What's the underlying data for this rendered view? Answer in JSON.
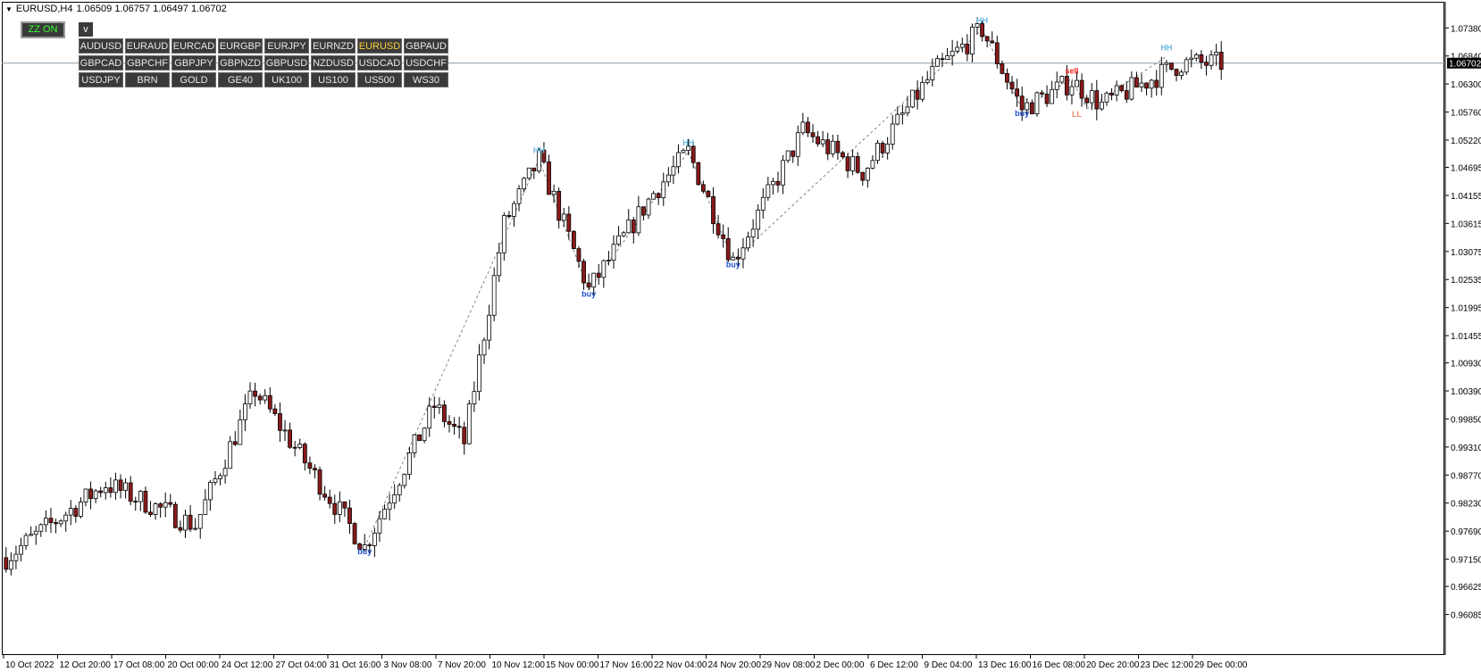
{
  "header": {
    "symbol_timeframe": "EURUSD,H4",
    "ohlc": "1.06509 1.06757 1.06497 1.06702"
  },
  "toolbar": {
    "zz_label": "ZZ ON",
    "v_label": "v"
  },
  "symbols": [
    [
      "AUDUSD",
      "EURAUD",
      "EURCAD",
      "EURGBP",
      "EURJPY",
      "EURNZD",
      "EURUSD",
      "GBPAUD"
    ],
    [
      "GBPCAD",
      "GBPCHF",
      "GBPJPY",
      "GBPNZD",
      "GBPUSD",
      "NZDUSD",
      "USDCAD",
      "USDCHF"
    ],
    [
      "USDJPY",
      "BRN",
      "GOLD",
      "GE40",
      "UK100",
      "US100",
      "US500",
      "WS30"
    ]
  ],
  "active_symbol": "EURUSD",
  "colors": {
    "bull": "#ffffff",
    "bear": "#8b1a1a",
    "wick": "#000000",
    "hh": "#6ab7e0",
    "buy": "#1f4fd1",
    "sell": "#ff2020",
    "ll": "#f28a6a",
    "price_line": "#8a9aa8",
    "zigzag": "#666666",
    "active_symbol_text": "#ffd23a",
    "zz_text": "#33ff33"
  },
  "chart_data": {
    "type": "candlestick",
    "symbol": "EURUSD",
    "timeframe": "H4",
    "current_price": 1.06702,
    "current_price_label": "1.06702",
    "ylim": [
      0.9606,
      1.0778
    ],
    "y_tick_labels": [
      "1.07380",
      "1.06840",
      "1.06300",
      "1.05760",
      "1.05220",
      "1.04695",
      "1.04155",
      "1.03615",
      "1.03075",
      "1.02535",
      "1.01995",
      "1.01455",
      "1.00930",
      "1.00390",
      "0.99850",
      "0.99310",
      "0.98770",
      "0.98230",
      "0.97690",
      "0.97150",
      "0.96625",
      "0.96085"
    ],
    "x_tick_labels": [
      "10 Oct 2022",
      "12 Oct 20:00",
      "17 Oct 08:00",
      "20 Oct 00:00",
      "24 Oct 12:00",
      "27 Oct 04:00",
      "31 Oct 16:00",
      "3 Nov 08:00",
      "7 Nov 20:00",
      "10 Nov 12:00",
      "15 Nov 00:00",
      "17 Nov 16:00",
      "22 Nov 04:00",
      "24 Nov 20:00",
      "29 Nov 08:00",
      "2 Dec 00:00",
      "6 Dec 12:00",
      "9 Dec 04:00",
      "13 Dec 16:00",
      "16 Dec 08:00",
      "20 Dec 20:00",
      "23 Dec 12:00",
      "29 Dec 00:00"
    ],
    "zigzag_anchors": [
      {
        "bar": 0,
        "price": 0.9718
      },
      {
        "bar": 20,
        "price": 0.986
      },
      {
        "bar": 38,
        "price": 0.978
      },
      {
        "bar": 50,
        "price": 1.004
      },
      {
        "bar": 72,
        "price": 0.9738
      },
      {
        "bar": 86,
        "price": 1.001
      },
      {
        "bar": 92,
        "price": 0.994
      },
      {
        "bar": 100,
        "price": 1.036
      },
      {
        "bar": 107,
        "price": 1.0485
      },
      {
        "bar": 117,
        "price": 1.0233
      },
      {
        "bar": 130,
        "price": 1.042
      },
      {
        "bar": 137,
        "price": 1.05
      },
      {
        "bar": 146,
        "price": 1.029
      },
      {
        "bar": 160,
        "price": 1.054
      },
      {
        "bar": 172,
        "price": 1.046
      },
      {
        "bar": 186,
        "price": 1.065
      },
      {
        "bar": 196,
        "price": 1.0735
      },
      {
        "bar": 204,
        "price": 1.0582
      },
      {
        "bar": 214,
        "price": 1.0635
      },
      {
        "bar": 220,
        "price": 1.059
      },
      {
        "bar": 228,
        "price": 1.063
      },
      {
        "bar": 236,
        "price": 1.067
      },
      {
        "bar": 241,
        "price": 1.067
      }
    ],
    "annotations": [
      {
        "text": "HH",
        "kind": "hh",
        "bar": 107,
        "price": 1.0497
      },
      {
        "text": "buy",
        "kind": "buy",
        "bar": 72,
        "price": 0.9725
      },
      {
        "text": "buy",
        "kind": "buy",
        "bar": 117,
        "price": 1.022
      },
      {
        "text": "HH",
        "kind": "hh",
        "bar": 137,
        "price": 1.0512
      },
      {
        "text": "buy",
        "kind": "buy",
        "bar": 146,
        "price": 1.0277
      },
      {
        "text": "HH",
        "kind": "hh",
        "bar": 196,
        "price": 1.0747
      },
      {
        "text": "buy",
        "kind": "buy",
        "bar": 204,
        "price": 1.0568
      },
      {
        "text": "sell",
        "kind": "sell",
        "bar": 214,
        "price": 1.065
      },
      {
        "text": "LL",
        "kind": "ll",
        "bar": 215,
        "price": 1.0567
      },
      {
        "text": "HH",
        "kind": "hh",
        "bar": 233,
        "price": 1.0695
      }
    ],
    "zigzag_lines": [
      [
        72,
        0.9738,
        107,
        1.0485
      ],
      [
        107,
        1.0485,
        117,
        1.0233
      ],
      [
        117,
        1.0233,
        137,
        1.05
      ],
      [
        137,
        1.05,
        146,
        1.029
      ],
      [
        146,
        1.029,
        196,
        1.0735
      ],
      [
        196,
        1.0735,
        204,
        1.0582
      ],
      [
        204,
        1.0582,
        214,
        1.064
      ],
      [
        214,
        1.064,
        217,
        1.0582
      ],
      [
        217,
        1.0582,
        233,
        1.0683
      ]
    ]
  }
}
